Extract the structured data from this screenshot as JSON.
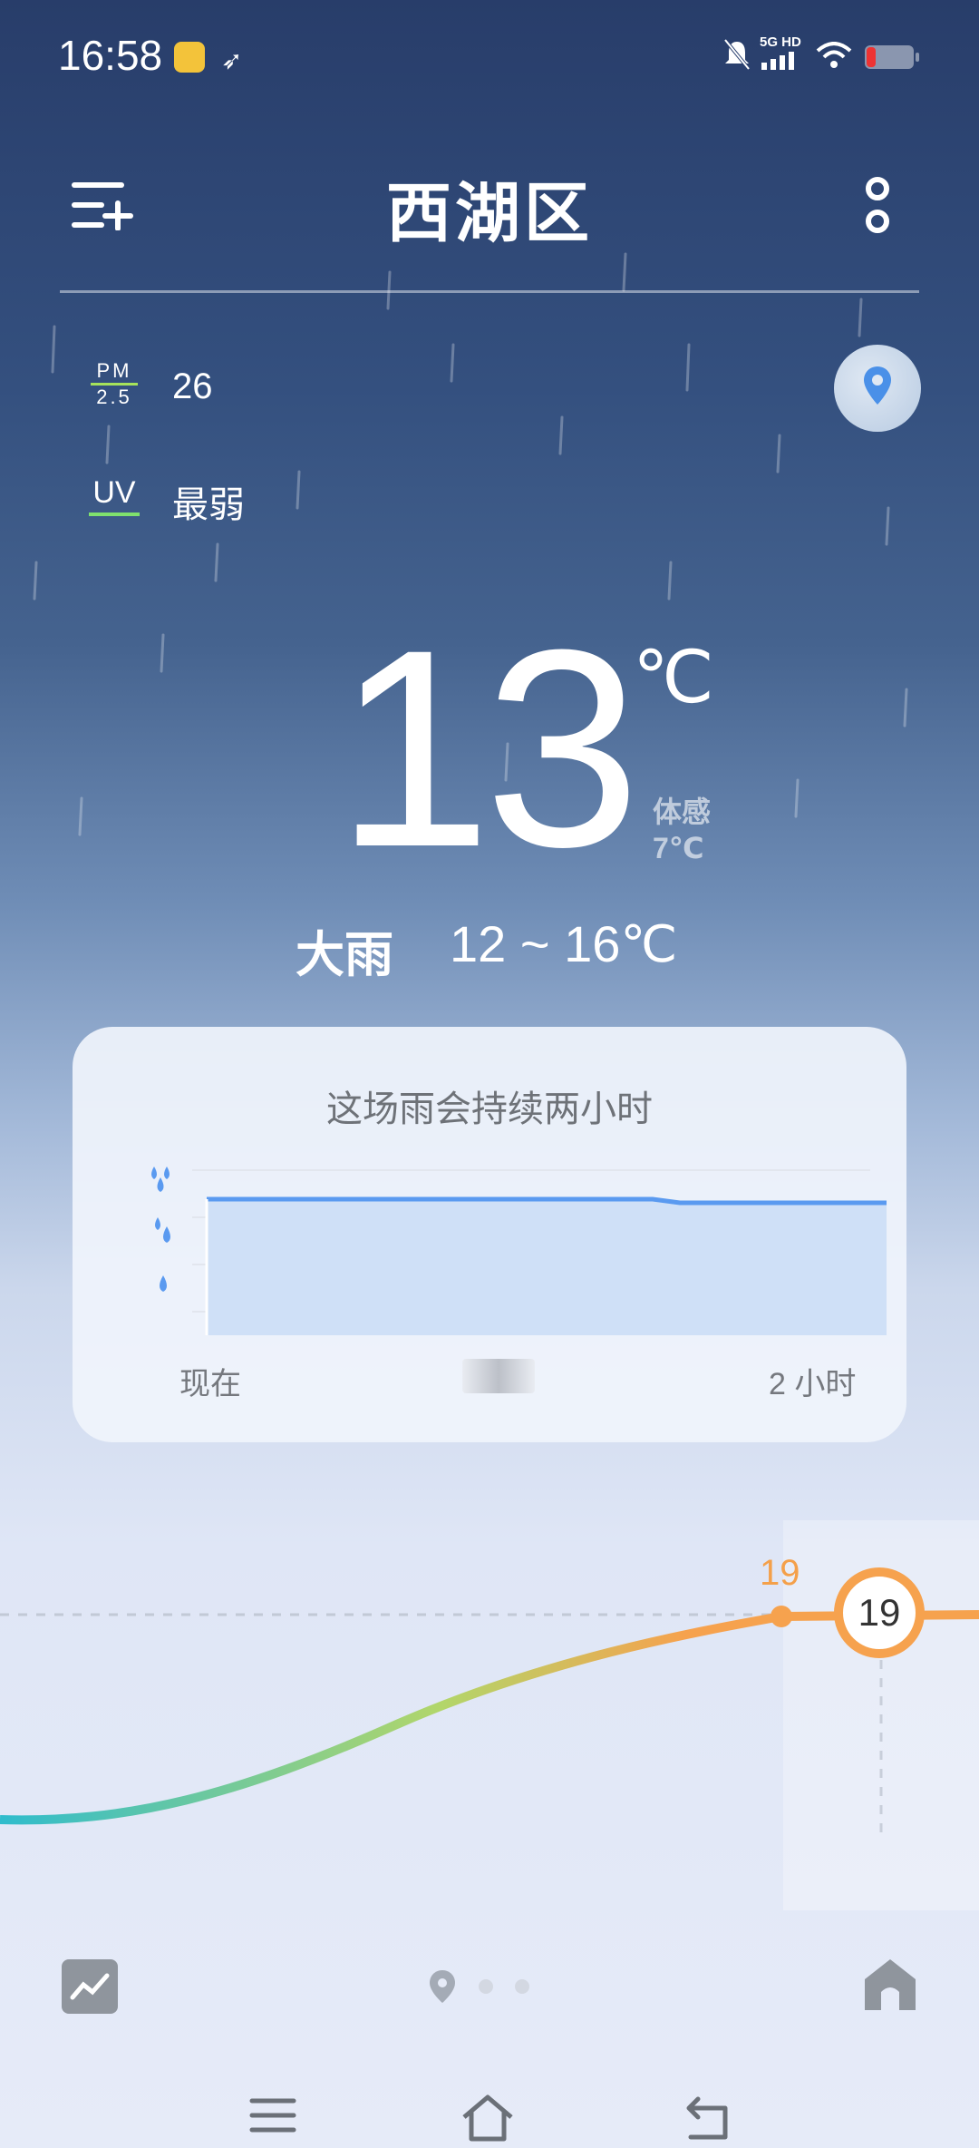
{
  "status_bar": {
    "time": "16:58",
    "network": "5G HD"
  },
  "header": {
    "city": "西湖区"
  },
  "air": {
    "pm_label_top": "PM",
    "pm_label_bottom": "2.5",
    "pm_value": "26",
    "uv_label": "UV",
    "uv_value": "最弱"
  },
  "current": {
    "temperature": "13",
    "unit": "℃",
    "feels_like_label": "体感",
    "feels_like_value": "7℃",
    "condition": "大雨",
    "range": "12 ~ 16℃"
  },
  "rain_card": {
    "title": "这场雨会持续两小时",
    "label_start": "现在",
    "label_end": "2 小时"
  },
  "hourly": {
    "peak_value": "19",
    "current_value": "19"
  },
  "colors": {
    "accent_orange": "#f6a24e",
    "rain_blue": "#5a9af0",
    "curve_start": "#2fbccd",
    "curve_mid": "#b2d66a"
  }
}
